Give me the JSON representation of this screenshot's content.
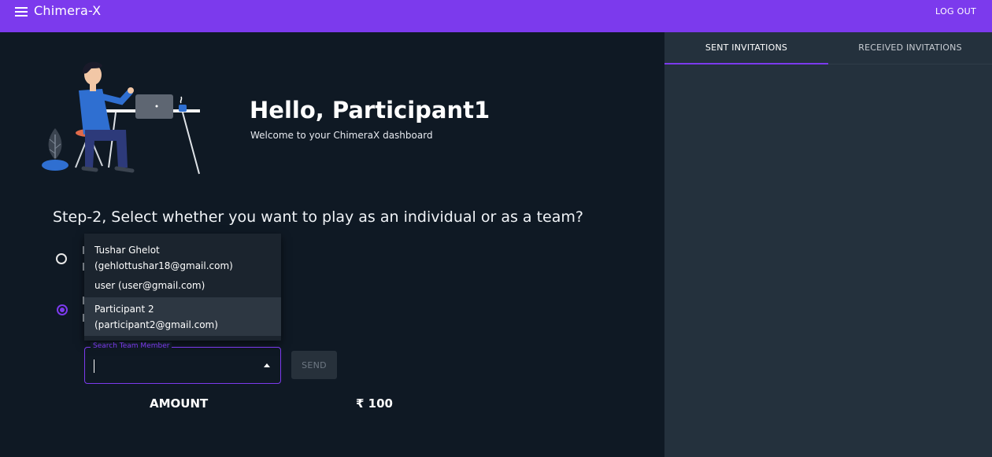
{
  "appbar": {
    "title": "Chimera-X",
    "logout_label": "LOG OUT"
  },
  "hero": {
    "greeting": "Hello, Participant1",
    "subtitle": "Welcome to your ChimeraX dashboard"
  },
  "step": {
    "title": "Step-2, Select whether you want to play as an individual or as a team?"
  },
  "team_search": {
    "label": "Search Team Member",
    "value": "",
    "options": [
      {
        "name": "Tushar Ghelot",
        "email": "(gehlottushar18@gmail.com)"
      },
      {
        "name": "user (user@gmail.com)",
        "email": ""
      },
      {
        "name": "Participant 2",
        "email": "(participant2@gmail.com)"
      }
    ],
    "send_label": "SEND"
  },
  "amount": {
    "label": "AMOUNT",
    "value": "₹ 100"
  },
  "tabs": [
    {
      "label": "SENT INVITATIONS"
    },
    {
      "label": "RECEIVED INVITATIONS"
    }
  ],
  "colors": {
    "accent": "#7c3aed",
    "background": "#0f1924",
    "panel": "#24313d"
  }
}
